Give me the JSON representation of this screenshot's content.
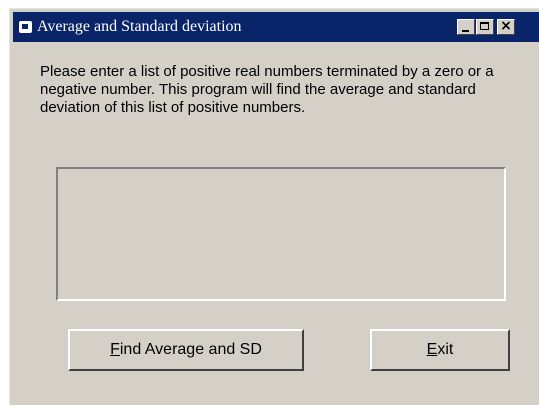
{
  "window": {
    "title": "Average and Standard deviation",
    "controls": {
      "minimize": "_",
      "maximize": "□",
      "close": "×"
    }
  },
  "message": "Please enter a list of positive real numbers terminated by a zero or a negative number. This program will find the average and standard deviation of this list of positive numbers.",
  "output_box": {
    "text": ""
  },
  "buttons": {
    "find": {
      "mnemonic": "F",
      "rest": "ind Average and SD"
    },
    "exit": {
      "mnemonic": "E",
      "rest": "xit"
    }
  },
  "icons": {
    "app": "application-icon",
    "minimize": "minimize-icon",
    "maximize": "maximize-icon",
    "close": "close-icon"
  },
  "colors": {
    "titlebar": "#0a246a",
    "face": "#d4d0c8",
    "title_text": "#ffffff"
  }
}
